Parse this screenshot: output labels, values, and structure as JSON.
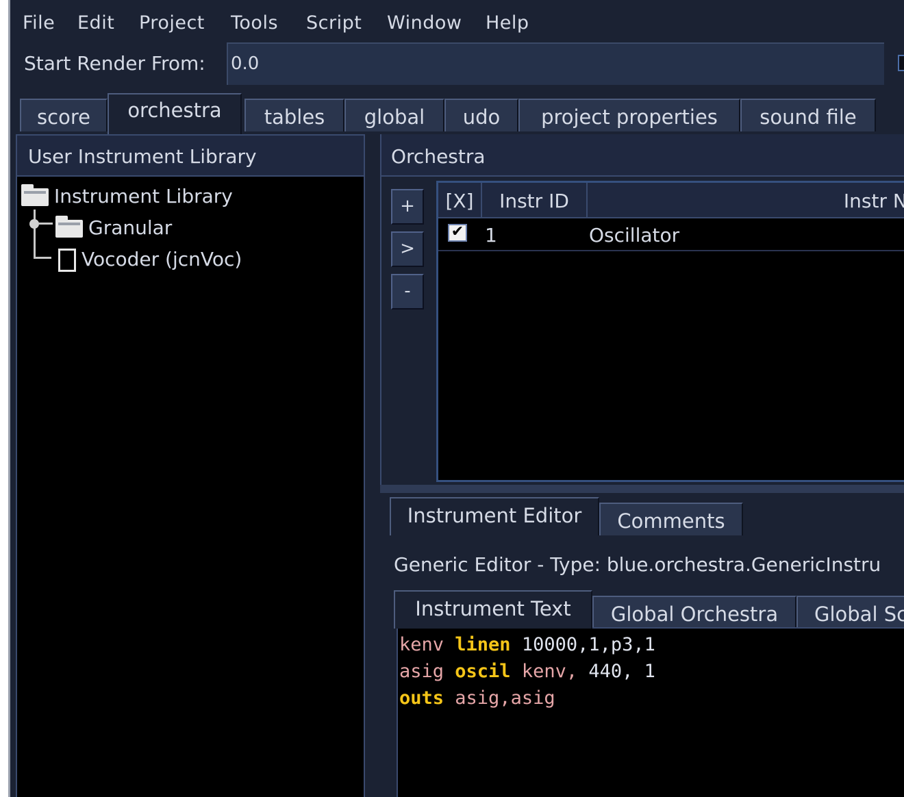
{
  "menu": {
    "items": [
      {
        "label": "File"
      },
      {
        "label": "Edit"
      },
      {
        "label": "Project"
      },
      {
        "label": "Tools"
      },
      {
        "label": "Script"
      },
      {
        "label": "Window"
      },
      {
        "label": "Help"
      }
    ]
  },
  "render": {
    "label": "Start Render From:",
    "value": "0.0"
  },
  "main_tabs": [
    {
      "label": "score"
    },
    {
      "label": "orchestra"
    },
    {
      "label": "tables"
    },
    {
      "label": "global"
    },
    {
      "label": "udo"
    },
    {
      "label": "project properties"
    },
    {
      "label": "sound file"
    }
  ],
  "library": {
    "header": "User Instrument Library",
    "root": "Instrument Library",
    "folder": "Granular",
    "file": "Vocoder (jcnVoc)"
  },
  "orchestra": {
    "header": "Orchestra",
    "buttons": {
      "add": "+",
      "copy": ">",
      "remove": "-"
    },
    "columns": [
      "[X]",
      "Instr ID",
      "Instr Na"
    ],
    "rows": [
      {
        "enabled": "✔",
        "id": "1",
        "name": "Oscillator"
      }
    ]
  },
  "editor": {
    "tabs": [
      {
        "label": "Instrument Editor"
      },
      {
        "label": "Comments"
      }
    ],
    "type_label": "Generic Editor - Type: blue.orchestra.GenericInstru",
    "sub_tabs": [
      {
        "label": "Instrument Text"
      },
      {
        "label": "Global Orchestra"
      },
      {
        "label": "Global Sc"
      }
    ],
    "code": {
      "line1": {
        "a": "kenv ",
        "b": "linen",
        "c": " 10000,1,p3,1"
      },
      "line2": {
        "a": "asig ",
        "b": "oscil",
        "c": " kenv,",
        "d": " 440, 1"
      },
      "line3": {
        "b": "outs",
        "a": " asig,asig"
      }
    }
  },
  "colors": {
    "background": "#1b2233",
    "panel_black": "#000000",
    "keyword": "#f5c518",
    "variable": "#e6a6a8"
  }
}
